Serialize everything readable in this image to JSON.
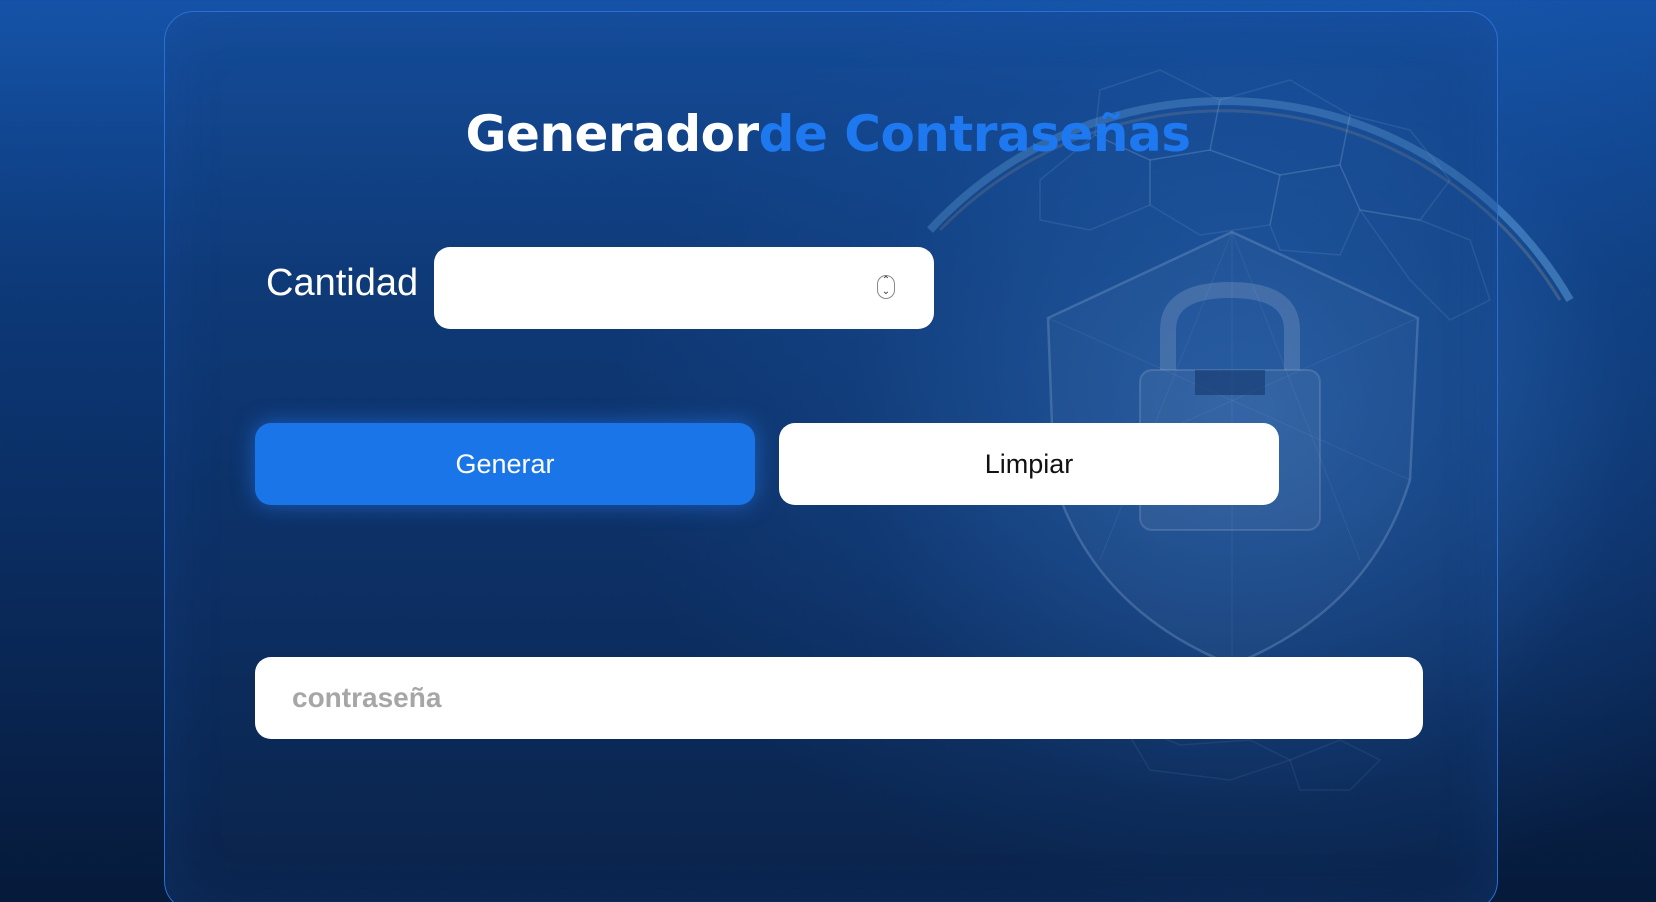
{
  "title": {
    "part1": "Generador",
    "part2": "de Contraseñas"
  },
  "form": {
    "quantity_label": "Cantidad",
    "quantity_value": "",
    "generate_label": "Generar",
    "clear_label": "Limpiar",
    "password_placeholder": "contraseña"
  },
  "icons": {
    "spinner": "number-spinner-icon",
    "background": "shield-lock-globe-icon"
  },
  "colors": {
    "accent": "#1a75e8",
    "title_accent": "#1e78f0",
    "card_border": "#2a6fd6"
  }
}
